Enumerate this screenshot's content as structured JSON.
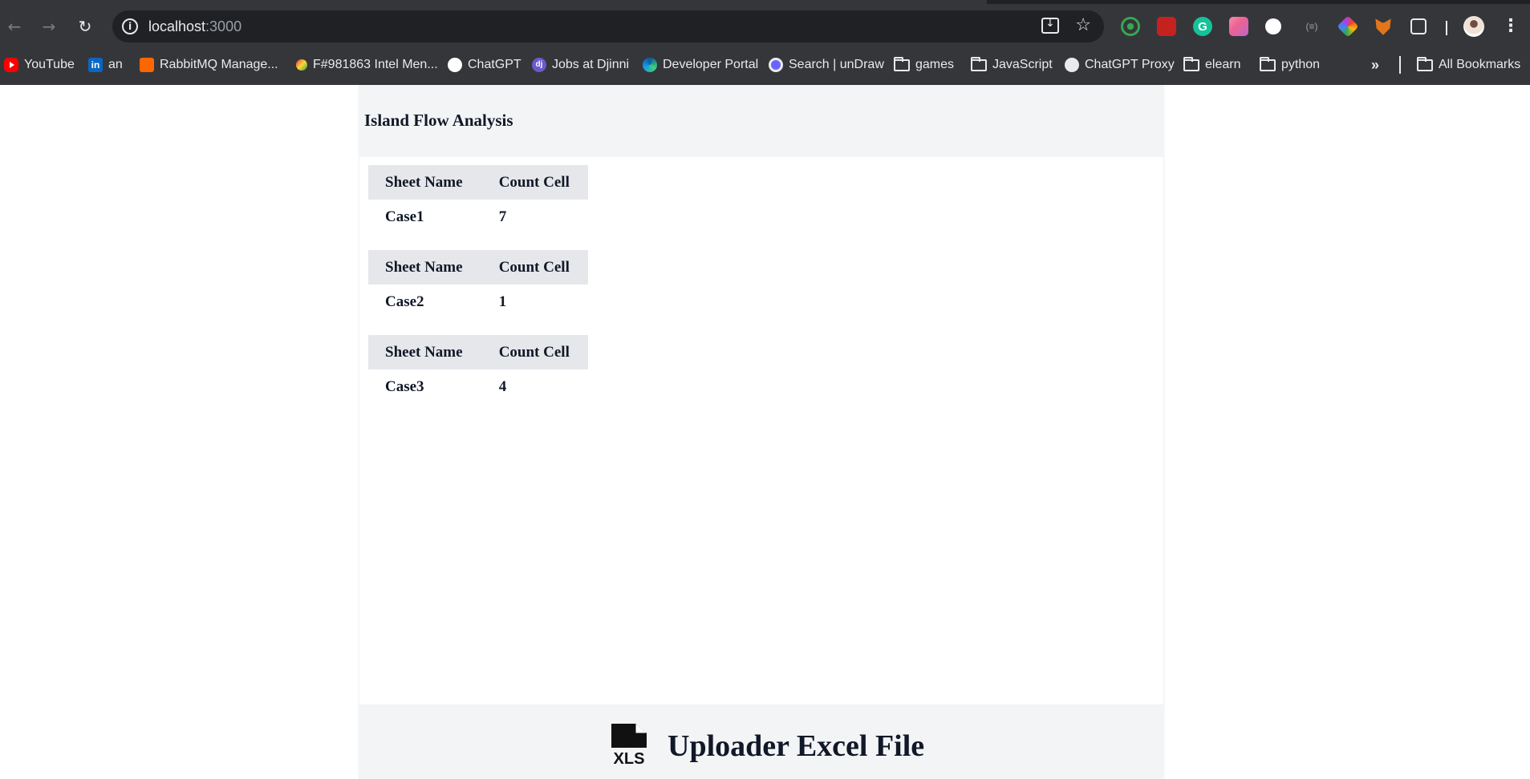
{
  "browser": {
    "url_host": "localhost",
    "url_port": ":3000",
    "bookmarks": [
      {
        "label": "YouTube",
        "icon": "youtube-icon"
      },
      {
        "label": "an",
        "icon": "linkedin-icon"
      },
      {
        "label": "RabbitMQ Manage...",
        "icon": "rabbitmq-icon"
      },
      {
        "label": "F#981863 Intel Men...",
        "icon": "site-icon"
      },
      {
        "label": "ChatGPT",
        "icon": "chatgpt-icon"
      },
      {
        "label": "Jobs at Djinni",
        "icon": "djinni-icon"
      },
      {
        "label": "Developer Portal",
        "icon": "edge-icon"
      },
      {
        "label": "Search | unDraw",
        "icon": "undraw-icon"
      },
      {
        "label": "games",
        "icon": "folder-icon"
      },
      {
        "label": "JavaScript",
        "icon": "folder-icon"
      },
      {
        "label": "ChatGPT Proxy",
        "icon": "globe-icon"
      },
      {
        "label": "elearn",
        "icon": "folder-icon"
      },
      {
        "label": "python",
        "icon": "folder-icon"
      }
    ],
    "more_label": "»",
    "all_bookmarks_label": "All Bookmarks"
  },
  "page": {
    "title": "Island Flow Analysis",
    "tables": [
      {
        "header_sheet": "Sheet Name",
        "header_count": "Count Cell",
        "sheet": "Case1",
        "count": "7"
      },
      {
        "header_sheet": "Sheet Name",
        "header_count": "Count Cell",
        "sheet": "Case2",
        "count": "1"
      },
      {
        "header_sheet": "Sheet Name",
        "header_count": "Count Cell",
        "sheet": "Case3",
        "count": "4"
      }
    ],
    "uploader": {
      "icon_text": "XLS",
      "title": "Uploader Excel File"
    }
  },
  "colors": {
    "chrome_bg": "#35363a",
    "omnibox_bg": "#202124",
    "header_bg": "#f3f4f6",
    "table_header_bg": "#e5e7eb",
    "text": "#111827"
  }
}
